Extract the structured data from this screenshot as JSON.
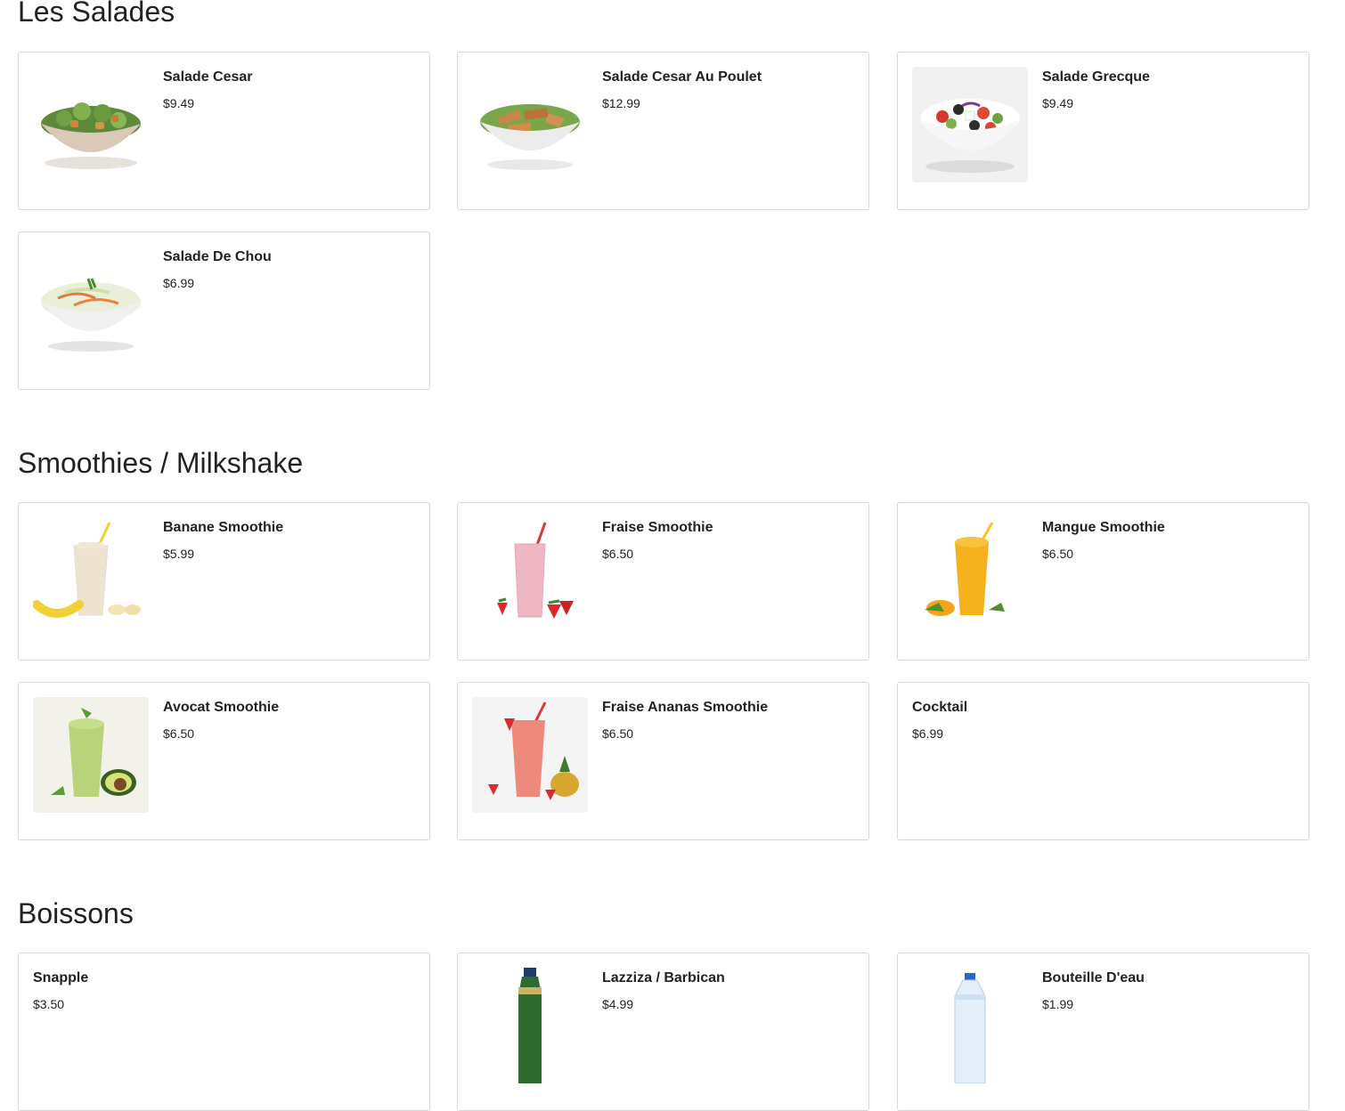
{
  "sections": [
    {
      "title": "Les Salades",
      "items": [
        {
          "name": "Salade Cesar",
          "price": "$9.49",
          "image": "caesar-salad-bowl"
        },
        {
          "name": "Salade Cesar Au Poulet",
          "price": "$12.99",
          "image": "chicken-caesar-salad-bowl"
        },
        {
          "name": "Salade Grecque",
          "price": "$9.49",
          "image": "greek-salad-bowl"
        },
        {
          "name": "Salade De Chou",
          "price": "$6.99",
          "image": "coleslaw-bowl"
        }
      ]
    },
    {
      "title": "Smoothies / Milkshake",
      "items": [
        {
          "name": "Banane Smoothie",
          "price": "$5.99",
          "image": "banana-smoothie-glass"
        },
        {
          "name": "Fraise Smoothie",
          "price": "$6.50",
          "image": "strawberry-smoothie-glass"
        },
        {
          "name": "Mangue Smoothie",
          "price": "$6.50",
          "image": "mango-smoothie-glass"
        },
        {
          "name": "Avocat Smoothie",
          "price": "$6.50",
          "image": "avocado-smoothie-glass"
        },
        {
          "name": "Fraise Ananas Smoothie",
          "price": "$6.50",
          "image": "strawberry-pineapple-smoothie-glass"
        },
        {
          "name": "Cocktail",
          "price": "$6.99",
          "image": null
        }
      ]
    },
    {
      "title": "Boissons",
      "items": [
        {
          "name": "Snapple",
          "price": "$3.50",
          "image": null
        },
        {
          "name": "Lazziza / Barbican",
          "price": "$4.99",
          "image": "green-bottle"
        },
        {
          "name": "Bouteille D'eau",
          "price": "$1.99",
          "image": "water-bottle"
        }
      ]
    }
  ],
  "colors": {
    "text": "#222222",
    "card_border": "#d8d8d8",
    "background": "#ffffff"
  }
}
